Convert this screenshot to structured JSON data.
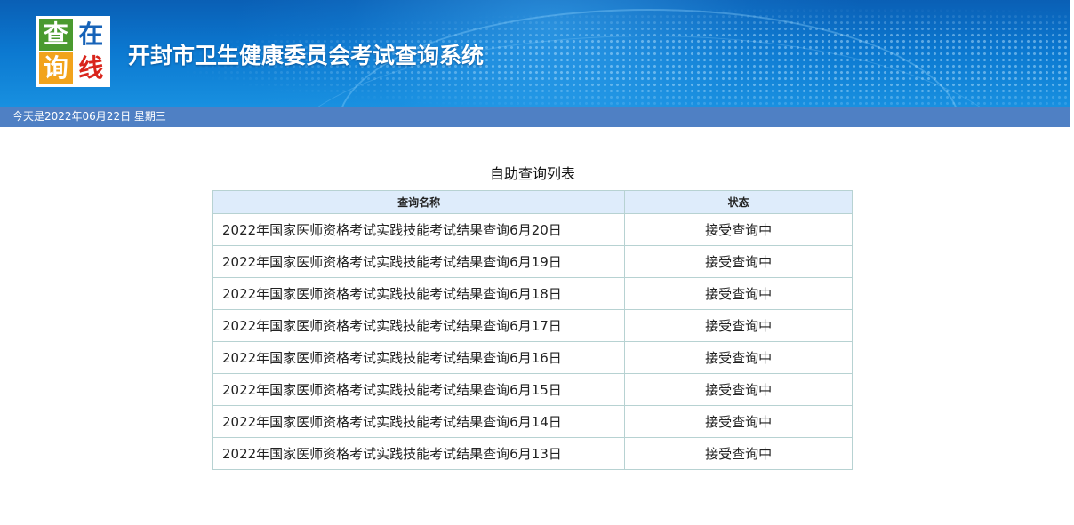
{
  "logo": {
    "chars": [
      "查",
      "在",
      "询",
      "线"
    ]
  },
  "header": {
    "title": "开封市卫生健康委员会考试查询系统"
  },
  "date_bar": {
    "today_text": "今天是2022年06月22日  星期三"
  },
  "main": {
    "list_title": "自助查询列表",
    "columns": [
      "查询名称",
      "状态"
    ],
    "rows": [
      {
        "name": "2022年国家医师资格考试实践技能考试结果查询6月20日",
        "status": "接受查询中"
      },
      {
        "name": "2022年国家医师资格考试实践技能考试结果查询6月19日",
        "status": "接受查询中"
      },
      {
        "name": "2022年国家医师资格考试实践技能考试结果查询6月18日",
        "status": "接受查询中"
      },
      {
        "name": "2022年国家医师资格考试实践技能考试结果查询6月17日",
        "status": "接受查询中"
      },
      {
        "name": "2022年国家医师资格考试实践技能考试结果查询6月16日",
        "status": "接受查询中"
      },
      {
        "name": "2022年国家医师资格考试实践技能考试结果查询6月15日",
        "status": "接受查询中"
      },
      {
        "name": "2022年国家医师资格考试实践技能考试结果查询6月14日",
        "status": "接受查询中"
      },
      {
        "name": "2022年国家医师资格考试实践技能考试结果查询6月13日",
        "status": "接受查询中"
      }
    ]
  },
  "colors": {
    "header_blue": "#0b77cf",
    "date_bar": "#4f80c4",
    "table_header_bg": "#deecfb",
    "table_border": "#b7d2d2"
  }
}
